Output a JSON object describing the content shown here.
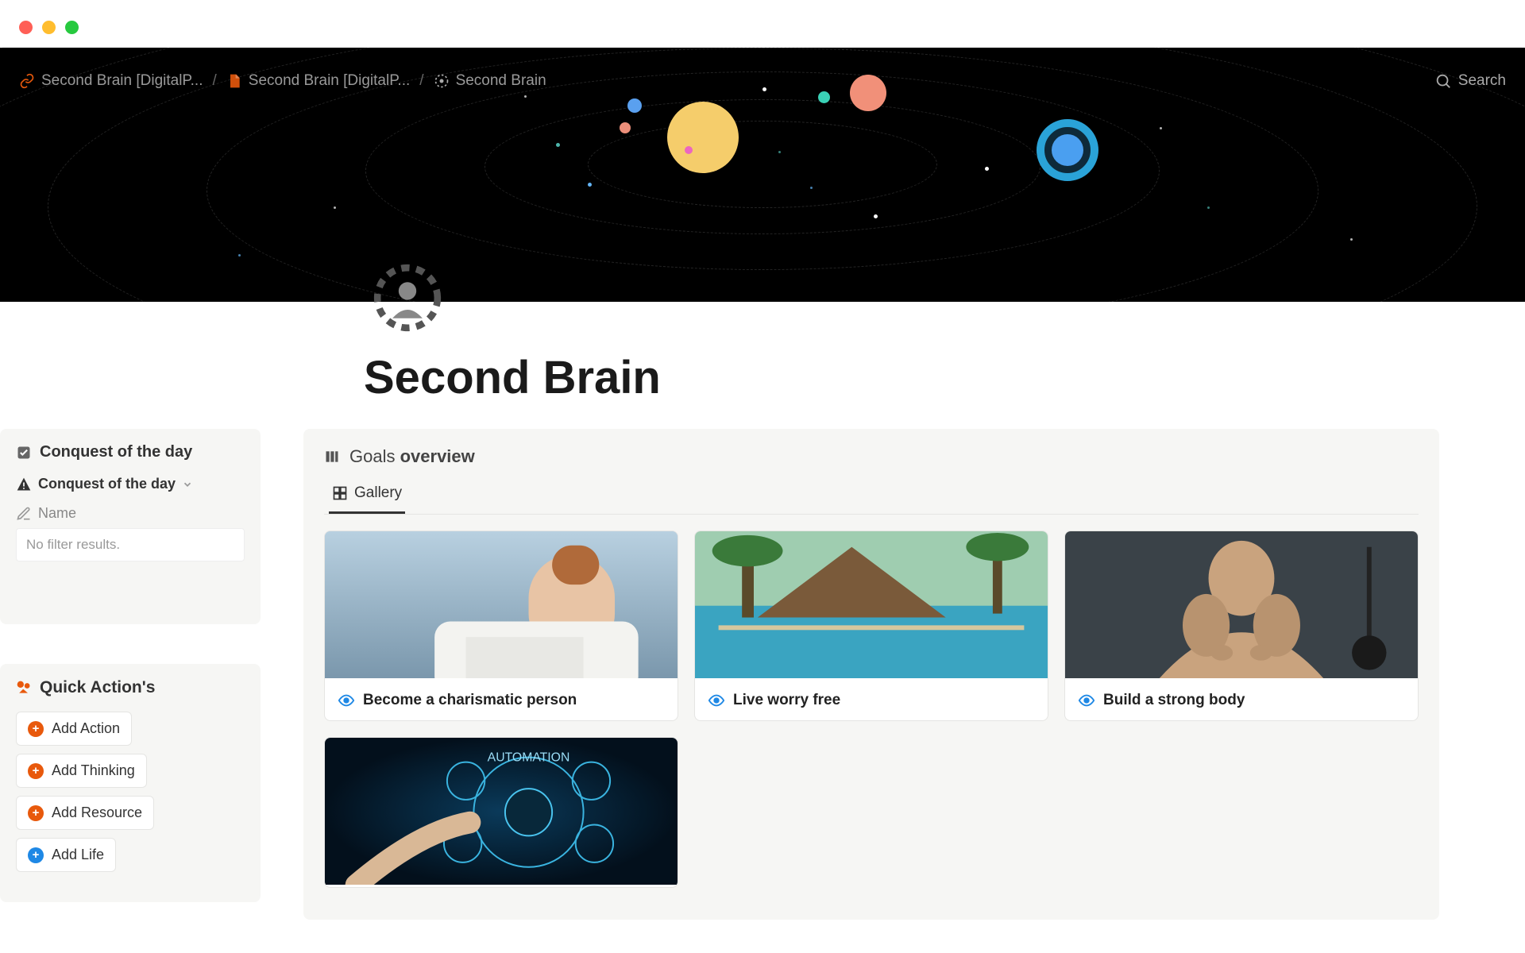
{
  "breadcrumbs": [
    {
      "label": "Second Brain [DigitalP..."
    },
    {
      "label": "Second Brain [DigitalP..."
    },
    {
      "label": "Second Brain"
    }
  ],
  "search_label": "Search",
  "page": {
    "title": "Second Brain"
  },
  "conquest": {
    "title": "Conquest of the day",
    "view_label": "Conquest of the day",
    "column_label": "Name",
    "empty_message": "No filter results."
  },
  "quick_actions": {
    "title": "Quick Action's",
    "buttons": [
      {
        "label": "Add Action",
        "color": "o"
      },
      {
        "label": "Add Thinking",
        "color": "o"
      },
      {
        "label": "Add Resource",
        "color": "o"
      },
      {
        "label": "Add Life",
        "color": "b"
      }
    ]
  },
  "goals": {
    "title_prefix": "Goals ",
    "title_strong": "overview",
    "tab_label": "Gallery",
    "cards": [
      {
        "label": "Become a charismatic person"
      },
      {
        "label": "Live worry free"
      },
      {
        "label": "Build a strong body"
      },
      {
        "label": ""
      }
    ]
  }
}
